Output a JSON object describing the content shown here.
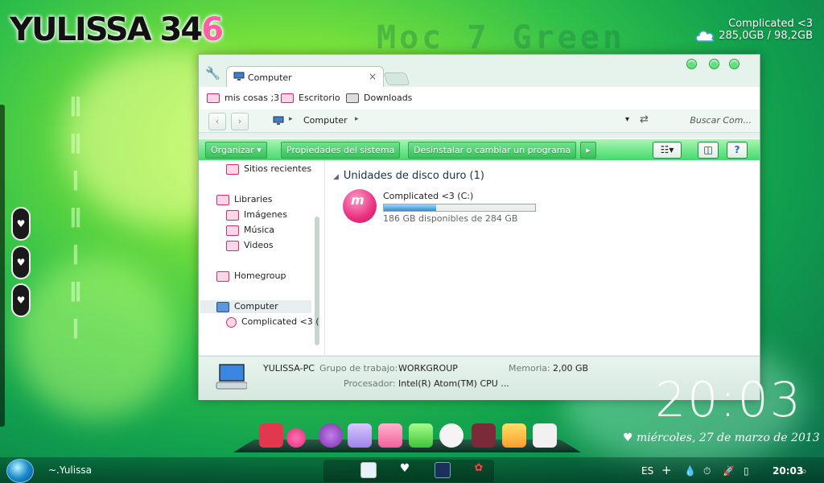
{
  "desktop": {
    "logo_main": "YULISSA 34",
    "logo_accent": "6",
    "watermark": "Moc 7 Green",
    "drive_gadget": {
      "name": "Complicated <3",
      "sizes": "285,0GB / 98,2GB"
    },
    "side_glyph": "♥"
  },
  "window": {
    "tab_label": "Computer",
    "tab_close": "×",
    "bookmarks": [
      "mis cosas ;3",
      "Escritorio",
      "Downloads"
    ],
    "address": {
      "back": "‹",
      "forward": "›",
      "path": "Computer",
      "sep": "▸",
      "search_placeholder": "Buscar Com..."
    },
    "toolbar": {
      "organize": "Organizar ▾",
      "system_props": "Propiedades del sistema",
      "uninstall": "Desinstalar o cambiar un programa",
      "more": "▸"
    },
    "nav": {
      "recent": "Sitios recientes",
      "libraries": "Libraries",
      "images": "Imágenes",
      "music": "Música",
      "videos": "Videos",
      "homegroup": "Homegroup",
      "computer": "Computer",
      "drive": "Complicated <3 ("
    },
    "content": {
      "group_header": "Unidades de disco duro (1)",
      "drive_name": "Complicated <3 (C:)",
      "drive_free": "186 GB disponibles de 284 GB",
      "used_fraction": 0.345
    },
    "details": {
      "pc_name": "YULISSA-PC",
      "workgroup_label": "Grupo de trabajo:",
      "workgroup": "WORKGROUP",
      "memory_label": "Memoria:",
      "memory": "2,00 GB",
      "cpu_label": "Procesador:",
      "cpu": "Intel(R) Atom(TM) CPU ..."
    }
  },
  "clock": {
    "time": "20:03",
    "date": "♥ miércoles, 27 de marzo de 2013"
  },
  "taskbar": {
    "user": "~.Yulissa",
    "lang": "ES",
    "time": "20:03",
    "plus": "+"
  },
  "colors": {
    "accent": "#45d96a",
    "pink": "#ff5fa6"
  }
}
